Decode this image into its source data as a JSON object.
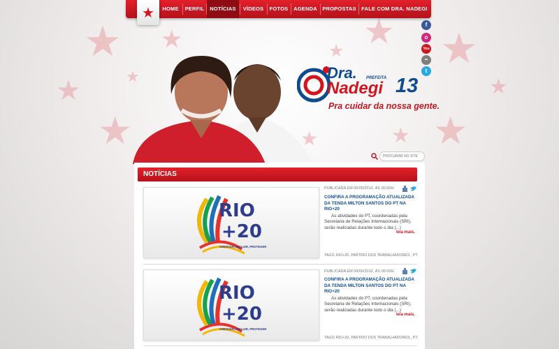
{
  "nav": {
    "logo_icon": "pt-star-icon",
    "items": [
      {
        "label": "HOME"
      },
      {
        "label": "PERFIL"
      },
      {
        "label": "NOTÍCIAS",
        "active": true
      },
      {
        "label": "VÍDEOS"
      },
      {
        "label": "FOTOS"
      },
      {
        "label": "AGENDA"
      },
      {
        "label": "PROPOSTAS"
      },
      {
        "label": "FALE COM DRA. NADEGI"
      }
    ]
  },
  "brand": {
    "line1": "Dra.",
    "prefeita": "PREFEITA",
    "name": "Nadegi",
    "number": "13",
    "slogan": "Pra cuidar da nossa gente."
  },
  "social": [
    {
      "icon": "facebook-icon",
      "color": "#3b5998",
      "glyph": "f"
    },
    {
      "icon": "orkut-icon",
      "color": "#d1267a",
      "glyph": "o"
    },
    {
      "icon": "youtube-icon",
      "color": "#cc181e",
      "glyph": "You"
    },
    {
      "icon": "flickr-icon",
      "color": "#7e7e7e",
      "glyph": "••"
    },
    {
      "icon": "twitter-icon",
      "color": "#2aa9e0",
      "glyph": "t"
    }
  ],
  "search": {
    "placeholder": "PROCURAR NO SITE"
  },
  "section": {
    "title": "NOTÍCIAS"
  },
  "posts": [
    {
      "meta": "PUBLICADA EM 00/00/2012, ÀS 00:00H.",
      "title": "CONFIRA A PROGRAMAÇÃO ATUALIZADA DA TENDA MILTON SANTOS DO PT NA RIO+20",
      "excerpt": "As atividades do PT, coordenadas pela Secretaria de Relações Internacionais (SRI), serão realizadas durante todo o dia (...)",
      "read_more": "leia mais.",
      "tags": "TAGS: RIO+20, PARTIDO DOS TRABALHADORES , PT.",
      "image_text": {
        "rio": "RIO",
        "plus": "+20",
        "sub": "CRESCER, INCLUIR, PROTEGER"
      }
    },
    {
      "meta": "PUBLICADA EM 00/00/2012, ÀS 00:00H.",
      "title": "CONFIRA A PROGRAMAÇÃO ATUALIZADA DA TENDA MILTON SANTOS DO PT NA RIO+20",
      "excerpt": "As atividades do PT, coordenadas pela Secretaria de Relações Internacionais (SRI), serão realizadas durante todo o dia (...)",
      "read_more": "leia mais.",
      "tags": "TAGS: RIO+20, PARTIDO DOS TRABALHADORES , PT.",
      "image_text": {
        "rio": "RIO",
        "plus": "+20",
        "sub": "CRESCER, INCLUIR, PROTEGER"
      }
    }
  ],
  "colors": {
    "brand_red": "#d4141d",
    "title_blue": "#0e4c8f"
  }
}
